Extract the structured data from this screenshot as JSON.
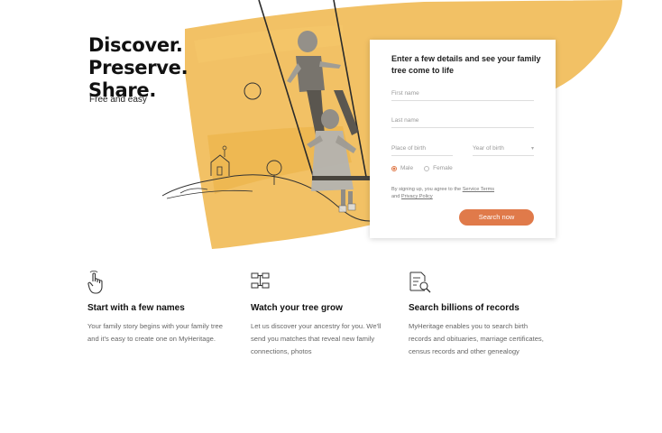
{
  "hero": {
    "headline_line1": "Discover.",
    "headline_line2": "Preserve.",
    "headline_line3": "Share.",
    "tagline": "Free and easy",
    "accent_color": "#f0b64a"
  },
  "form": {
    "title": "Enter a few details and see your family tree come to life",
    "first_name_placeholder": "First name",
    "last_name_placeholder": "Last name",
    "place_of_birth_placeholder": "Place of birth",
    "year_of_birth_placeholder": "Year of birth",
    "gender_options": [
      "Male",
      "Female"
    ],
    "selected_gender": "Male",
    "terms_prefix": "By signing up, you agree to the",
    "terms_link": "Service Terms",
    "terms_and": "and",
    "privacy_link": "Privacy Policy",
    "submit_label": "Search now",
    "button_color": "#e07a4a"
  },
  "features": [
    {
      "icon": "hand-pointer-icon",
      "title": "Start with a few names",
      "description": "Your family story begins with your family tree and it's easy to create one on MyHeritage."
    },
    {
      "icon": "family-tree-icon",
      "title": "Watch your tree grow",
      "description": "Let us discover your ancestry for you. We'll send you matches that reveal new family connections, photos"
    },
    {
      "icon": "document-search-icon",
      "title": "Search billions of records",
      "description": "MyHeritage enables you to search birth records and obituaries, marriage certificates, census records and other genealogy"
    }
  ]
}
